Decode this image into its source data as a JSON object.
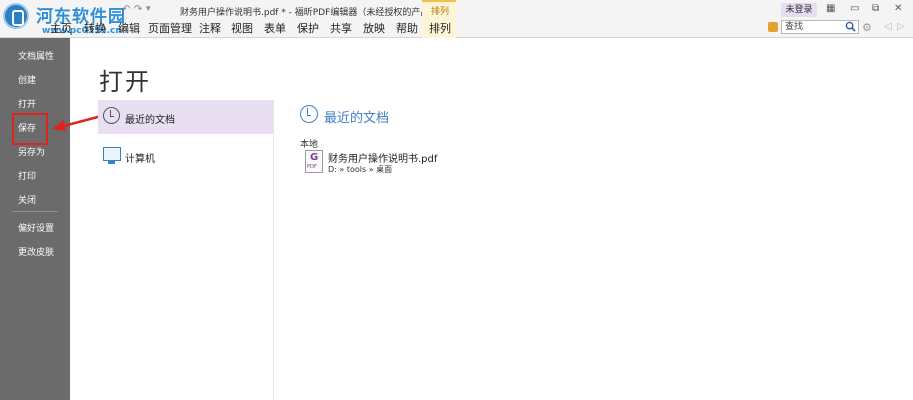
{
  "watermark": {
    "title": "河东软件园",
    "url": "www.pc0359.cn"
  },
  "quick_access": {
    "undo": "↶",
    "redo": "↷",
    "more": "▾"
  },
  "window": {
    "title": "财务用户操作说明书.pdf * - 福昕PDF编辑器（未经授权的产品）"
  },
  "context_group": "排列",
  "menu": [
    {
      "label": "主页"
    },
    {
      "label": "转换"
    },
    {
      "label": "编辑"
    },
    {
      "label": "页面管理"
    },
    {
      "label": "注释"
    },
    {
      "label": "视图"
    },
    {
      "label": "表单"
    },
    {
      "label": "保护"
    },
    {
      "label": "共享"
    },
    {
      "label": "放映"
    },
    {
      "label": "帮助"
    },
    {
      "label": "排列"
    }
  ],
  "account": {
    "login": "未登录"
  },
  "window_controls": {
    "layout": "▦",
    "minimize": "▭",
    "restore": "⧉",
    "close": "✕"
  },
  "search": {
    "placeholder": "查找"
  },
  "icons": {
    "gear": "⚙",
    "prev": "◁",
    "next": "▷"
  },
  "sidebar": {
    "items": [
      {
        "label": "文档属性"
      },
      {
        "label": "创建"
      },
      {
        "label": "打开"
      },
      {
        "label": "保存"
      },
      {
        "label": "另存为"
      },
      {
        "label": "打印"
      },
      {
        "label": "关闭"
      },
      {
        "label": "偏好设置"
      },
      {
        "label": "更改皮肤"
      }
    ]
  },
  "main": {
    "heading": "打开",
    "nav": [
      {
        "label": "最近的文档",
        "icon": "clock-icon",
        "selected": true
      },
      {
        "label": "计算机",
        "icon": "computer-icon",
        "selected": false
      }
    ],
    "recent": {
      "title": "最近的文档",
      "group": "本地",
      "files": [
        {
          "name": "财务用户操作说明书.pdf",
          "path": "D: » tools » 桌面",
          "icon_text": "PDF"
        }
      ]
    }
  },
  "colors": {
    "accent": "#3f80c5",
    "sidebar": "#6b6b6b",
    "selected": "#e9dff2",
    "annotation": "#e0241b"
  }
}
